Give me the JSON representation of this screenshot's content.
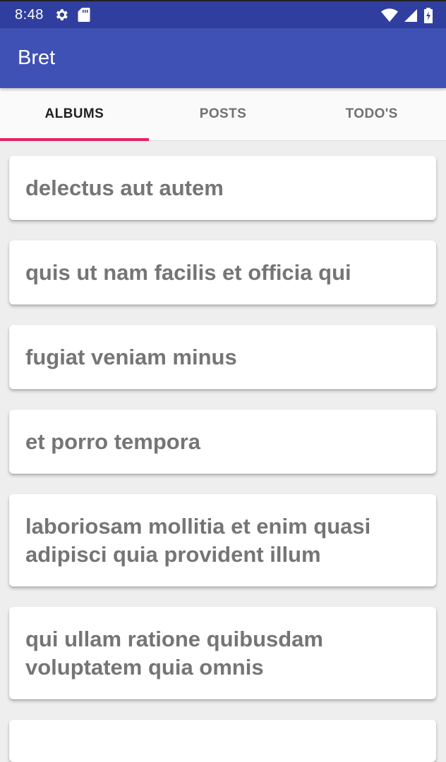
{
  "status_bar": {
    "time": "8:48",
    "icons": [
      "settings-gear-icon",
      "sd-card-icon",
      "wifi-icon",
      "cellular-signal-icon",
      "battery-charging-icon"
    ]
  },
  "app_bar": {
    "title": "Bret"
  },
  "tabs": [
    {
      "label": "ALBUMS",
      "active": true
    },
    {
      "label": "POSTS",
      "active": false
    },
    {
      "label": "TODO'S",
      "active": false
    }
  ],
  "albums": [
    {
      "title": "delectus aut autem"
    },
    {
      "title": "quis ut nam facilis et officia qui"
    },
    {
      "title": "fugiat veniam minus"
    },
    {
      "title": "et porro tempora"
    },
    {
      "title": "laboriosam mollitia et enim quasi adipisci quia provident illum"
    },
    {
      "title": "qui ullam ratione quibusdam voluptatem quia omnis"
    },
    {
      "title": ""
    }
  ],
  "colors": {
    "status_bar": "#303f9f",
    "app_bar": "#3f51b5",
    "tab_indicator": "#e91e63",
    "card_text": "#757575"
  }
}
